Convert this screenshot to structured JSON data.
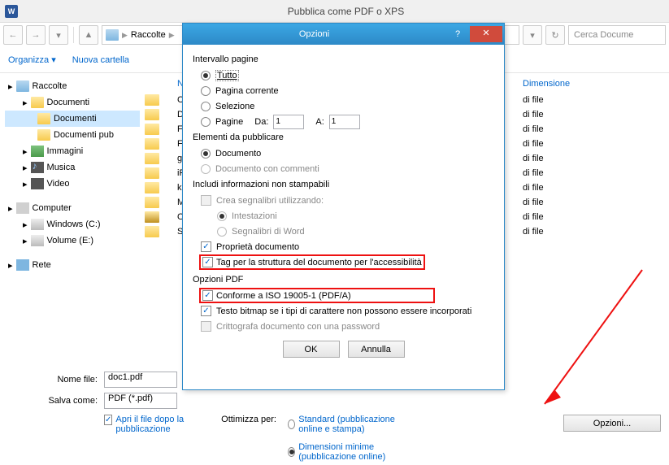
{
  "window": {
    "title": "Pubblica come PDF o XPS"
  },
  "nav": {
    "crumb1": "Raccolte",
    "search_placeholder": "Cerca Docume"
  },
  "cmd": {
    "organize": "Organizza ▾",
    "newfolder": "Nuova cartella"
  },
  "tree": {
    "raccolte": "Raccolte",
    "documenti": "Documenti",
    "documenti2": "Documenti",
    "documenti_pub": "Documenti pub",
    "immagini": "Immagini",
    "musica": "Musica",
    "video": "Video",
    "computer": "Computer",
    "win_c": "Windows (C:)",
    "vol_e": "Volume (E:)",
    "rete": "Rete"
  },
  "list": {
    "header_nome": "Nome",
    "header_dim": "Dimensione",
    "difile": "di file",
    "rows": [
      "C",
      "D",
      "F",
      "F",
      "g",
      "iP",
      "kl",
      "M",
      "O",
      "S"
    ]
  },
  "form": {
    "nome_lbl": "Nome file:",
    "nome_val": "doc1.pdf",
    "salva_lbl": "Salva come:",
    "salva_val": "PDF (*.pdf)",
    "apri_chk": "Apri il file dopo la pubblicazione",
    "ottimizza": "Ottimizza per:",
    "standard": "Standard (pubblicazione online e stampa)",
    "dim_min": "Dimensioni minime (pubblicazione online)",
    "opzioni_btn": "Opzioni..."
  },
  "dlg": {
    "title": "Opzioni",
    "grp_intervallo": "Intervallo pagine",
    "tutto": "Tutto",
    "pagina_corrente": "Pagina corrente",
    "selezione": "Selezione",
    "pagine": "Pagine",
    "da": "Da:",
    "a": "A:",
    "val1": "1",
    "grp_elementi": "Elementi da pubblicare",
    "documento": "Documento",
    "doc_commenti": "Documento con commenti",
    "grp_includi": "Includi informazioni non stampabili",
    "crea_seg": "Crea segnalibri utilizzando:",
    "intest": "Intestazioni",
    "seg_word": "Segnalibri di Word",
    "prop_doc": "Proprietà documento",
    "tag_acc": "Tag per la struttura del documento per l'accessibilità",
    "grp_pdf": "Opzioni PDF",
    "iso": "Conforme a ISO 19005-1 (PDF/A)",
    "bitmap": "Testo bitmap se i tipi di carattere non possono essere incorporati",
    "critto": "Crittografa documento con una password",
    "ok": "OK",
    "annulla": "Annulla"
  }
}
